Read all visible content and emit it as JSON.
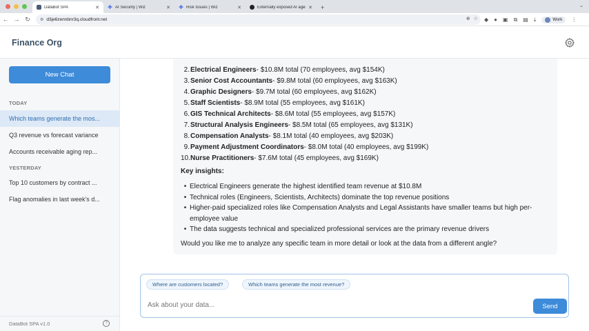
{
  "browser": {
    "tabs": [
      {
        "title": "DataBot SPA"
      },
      {
        "title": "AI Security | Wiz"
      },
      {
        "title": "Risk Issues | Wiz"
      },
      {
        "title": "Externally exposed AI agent"
      }
    ],
    "url": "d3je6zennbnr3q.cloudfront.net",
    "profile_label": "Work"
  },
  "app": {
    "title": "Finance Org",
    "new_chat_label": "New Chat",
    "version": "DataBot SPA v1.0"
  },
  "sidebar": {
    "today_label": "TODAY",
    "yesterday_label": "YESTERDAY",
    "today": [
      {
        "label": "Which teams generate the mos..."
      },
      {
        "label": "Q3 revenue vs forecast variance"
      },
      {
        "label": "Accounts receivable aging rep..."
      }
    ],
    "yesterday": [
      {
        "label": "Top 10 customers by contract ..."
      },
      {
        "label": "Flag anomalies in last week's d..."
      }
    ]
  },
  "message": {
    "teams": [
      {
        "num": "2.",
        "name": "Electrical Engineers",
        "detail": " - $10.8M total (70 employees, avg $154K)"
      },
      {
        "num": "3.",
        "name": "Senior Cost Accountants",
        "detail": " - $9.8M total (60 employees, avg $163K)"
      },
      {
        "num": "4.",
        "name": "Graphic Designers",
        "detail": " - $9.7M total (60 employees, avg $162K)"
      },
      {
        "num": "5.",
        "name": "Staff Scientists",
        "detail": " - $8.9M total (55 employees, avg $161K)"
      },
      {
        "num": "6.",
        "name": "GIS Technical Architects",
        "detail": " - $8.6M total (55 employees, avg $157K)"
      },
      {
        "num": "7.",
        "name": "Structural Analysis Engineers",
        "detail": " - $8.5M total (65 employees, avg $131K)"
      },
      {
        "num": "8.",
        "name": "Compensation Analysts",
        "detail": " - $8.1M total (40 employees, avg $203K)"
      },
      {
        "num": "9.",
        "name": "Payment Adjustment Coordinators",
        "detail": " - $8.0M total (40 employees, avg $199K)"
      },
      {
        "num": "10.",
        "name": "Nurse Practitioners",
        "detail": " - $7.6M total (45 employees, avg $169K)"
      }
    ],
    "insights_heading": "Key insights:",
    "insights": [
      "Electrical Engineers generate the highest identified team revenue at $10.8M",
      "Technical roles (Engineers, Scientists, Architects) dominate the top revenue positions",
      "Higher-paid specialized roles like Compensation Analysts and Legal Assistants have smaller teams but high per-employee value",
      "The data suggests technical and specialized professional services are the primary revenue drivers"
    ],
    "followup": "Would you like me to analyze any specific team in more detail or look at the data from a different angle?"
  },
  "composer": {
    "suggestions": [
      "Where are customers located?",
      "Which teams generate the most revenue?"
    ],
    "placeholder": "Ask about your data...",
    "send_label": "Send"
  }
}
